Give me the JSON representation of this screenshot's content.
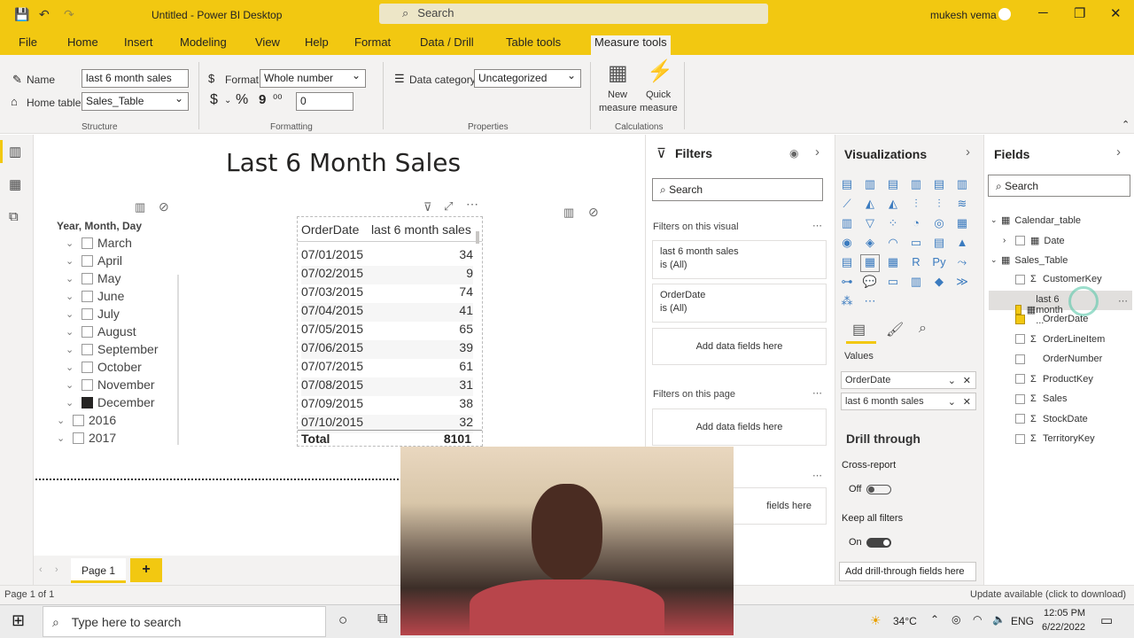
{
  "titlebar": {
    "title": "Untitled - Power BI Desktop",
    "search_placeholder": "Search",
    "user": "mukesh vema"
  },
  "menu": [
    "File",
    "Home",
    "Insert",
    "Modeling",
    "View",
    "Help",
    "Format",
    "Data / Drill",
    "Table tools",
    "Measure tools"
  ],
  "ribbon": {
    "name_label": "Name",
    "name_value": "last 6 month sales",
    "home_table_label": "Home table",
    "home_table_value": "Sales_Table",
    "structure_caption": "Structure",
    "format_label": "Format",
    "format_value": "Whole number",
    "currency_symbol": "$",
    "percent_symbol": "%",
    "comma_symbol": "9",
    "decimal_symbol": "⁰⁰",
    "decimals_value": "0",
    "formatting_caption": "Formatting",
    "data_category_label": "Data category",
    "data_category_value": "Uncategorized",
    "properties_caption": "Properties",
    "new_measure_1": "New",
    "new_measure_2": "measure",
    "quick_measure_1": "Quick",
    "quick_measure_2": "measure",
    "calculations_caption": "Calculations"
  },
  "report": {
    "title": "Last 6 Month Sales",
    "slicer_header": "Year, Month, Day",
    "slicer_items": [
      {
        "label": "March",
        "checked": false
      },
      {
        "label": "April",
        "checked": false
      },
      {
        "label": "May",
        "checked": false
      },
      {
        "label": "June",
        "checked": false
      },
      {
        "label": "July",
        "checked": false
      },
      {
        "label": "August",
        "checked": false
      },
      {
        "label": "September",
        "checked": false
      },
      {
        "label": "October",
        "checked": false
      },
      {
        "label": "November",
        "checked": false
      },
      {
        "label": "December",
        "checked": true
      }
    ],
    "slicer_years": [
      "2016",
      "2017"
    ],
    "table": {
      "col1": "OrderDate",
      "col2": "last 6 month sales",
      "rows": [
        {
          "date": "07/01/2015",
          "value": "34"
        },
        {
          "date": "07/02/2015",
          "value": "9"
        },
        {
          "date": "07/03/2015",
          "value": "74"
        },
        {
          "date": "07/04/2015",
          "value": "41"
        },
        {
          "date": "07/05/2015",
          "value": "65"
        },
        {
          "date": "07/06/2015",
          "value": "39"
        },
        {
          "date": "07/07/2015",
          "value": "61"
        },
        {
          "date": "07/08/2015",
          "value": "31"
        },
        {
          "date": "07/09/2015",
          "value": "38"
        },
        {
          "date": "07/10/2015",
          "value": "32"
        }
      ],
      "total_label": "Total",
      "total_value": "8101"
    }
  },
  "filters": {
    "title": "Filters",
    "search_placeholder": "Search",
    "on_visual": "Filters on this visual",
    "card1_name": "last 6 month sales",
    "card1_state": "is (All)",
    "card2_name": "OrderDate",
    "card2_state": "is (All)",
    "add_fields": "Add data fields here",
    "on_page": "Filters on this page",
    "partial_add": "fields here"
  },
  "visualizations": {
    "title": "Visualizations",
    "values_label": "Values",
    "well1": "OrderDate",
    "well2": "last 6 month sales",
    "drill_through": "Drill through",
    "cross_report": "Cross-report",
    "cross_report_state": "Off",
    "keep_filters": "Keep all filters",
    "keep_filters_state": "On",
    "add_drill": "Add drill-through fields here"
  },
  "fields": {
    "title": "Fields",
    "search_placeholder": "Search",
    "calendar_table": "Calendar_table",
    "date": "Date",
    "sales_table": "Sales_Table",
    "items": [
      {
        "label": "CustomerKey",
        "checked": false
      },
      {
        "label": "last 6 month ...",
        "checked": true
      },
      {
        "label": "OrderDate",
        "checked": true
      },
      {
        "label": "OrderLineItem",
        "checked": false
      },
      {
        "label": "OrderNumber",
        "checked": false
      },
      {
        "label": "ProductKey",
        "checked": false
      },
      {
        "label": "Sales",
        "checked": false
      },
      {
        "label": "StockDate",
        "checked": false
      },
      {
        "label": "TerritoryKey",
        "checked": false
      }
    ]
  },
  "pages": {
    "tab": "Page 1",
    "add": "+"
  },
  "status": {
    "left": "Page 1 of 1",
    "right": "Update available (click to download)"
  },
  "taskbar": {
    "search_placeholder": "Type here to search",
    "temperature": "34°C",
    "lang": "ENG",
    "time": "12:05 PM",
    "date": "6/22/2022"
  },
  "colors": {
    "accent": "#f2c811",
    "ribbon_bg": "#f3f2f1",
    "selection": "#e1dfdd"
  }
}
